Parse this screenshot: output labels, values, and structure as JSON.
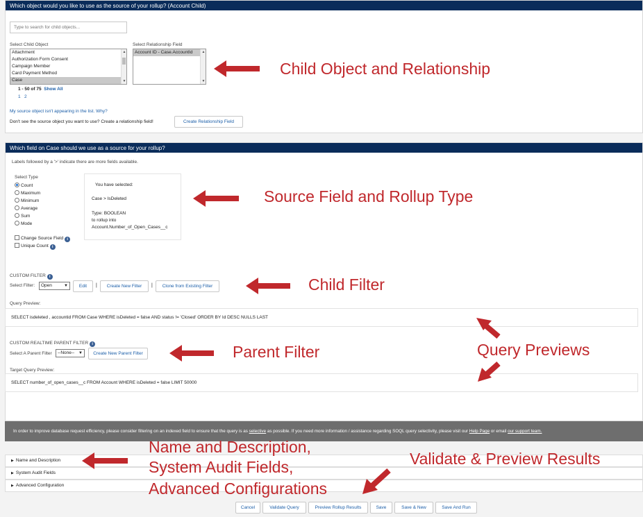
{
  "section1": {
    "header": "Which object would you like to use as the source of your rollup? (Account Child)",
    "search_placeholder": "Type to search for child objects...",
    "child_object_label": "Select Child Object",
    "child_objects": [
      "Attachment",
      "Authorization Form Consent",
      "Campaign Member",
      "Card Payment Method",
      "Case"
    ],
    "relationship_label": "Select Relationship Field",
    "relationship_fields": [
      "Account ID - Case.AccountId"
    ],
    "pagination_count": "1 - 50 of 75",
    "show_all": "Show All",
    "pages": [
      "1",
      "2"
    ],
    "missing_source_link": "My source object isn't appearing in the list. Why?",
    "create_prompt": "Don't see the source object you want to use? Create a relationship field!",
    "create_relationship_button": "Create Relationship Field"
  },
  "section2": {
    "header": "Which field on Case should we use as a source for your rollup?",
    "hint": "Labels followed by a '>' indicate there are more fields available.",
    "select_type_label": "Select Type",
    "types": [
      "Count",
      "Maximum",
      "Minimum",
      "Average",
      "Sum",
      "Mode"
    ],
    "selected_type_index": 0,
    "change_source_field": "Change Source Field",
    "unique_count": "Unique Count",
    "selected_box": {
      "title": "You have selected:",
      "path": "Case > IsDeleted",
      "type_line": "Type: BOOLEAN",
      "rollup_into": "to rollup into",
      "target": "Account.Number_of_Open_Cases__c"
    },
    "custom_filter_label": "CUSTOM FILTER",
    "select_filter_label": "Select Filter:",
    "filter_value": "Open",
    "edit_button": "Edit",
    "separator": "|",
    "create_filter_button": "Create New Filter",
    "clone_filter_button": "Clone from Existing Filter",
    "query_preview_label": "Query Preview:",
    "query_preview": "SELECT isdeleted , accountid FROM Case WHERE isDeleted = false AND status != 'Closed' ORDER BY Id DESC NULLS LAST",
    "parent_filter_label": "CUSTOM REALTIME PARENT FILTER",
    "select_parent_filter_label": "Select A Parent Filter",
    "parent_filter_value": "--None--",
    "create_parent_filter_button": "Create New Parent Filter",
    "target_query_label": "Target Query Preview:",
    "target_query": "SELECT number_of_open_cases__c FROM Account WHERE isDeleted = false LIMIT 50000"
  },
  "notice": {
    "text_before": "In order to improve database request efficiency, please consider filtering on an indexed field to ensure that the query is as",
    "selective_link": "selective",
    "text_middle": "as possible. If you need more information / assistance regarding SOQL query selectivity, please visit our",
    "help_link": "Help Page",
    "text_or": "or email",
    "support_link": "our support team."
  },
  "accordions": [
    "Name and Description",
    "System Audit Fields",
    "Advanced Configuration"
  ],
  "footer_buttons": [
    "Cancel",
    "Validate Query",
    "Preview Rollup Results",
    "Save",
    "Save & New",
    "Save And Run"
  ],
  "annotations": {
    "child_object": "Child Object and Relationship",
    "source_field": "Source Field and Rollup Type",
    "child_filter": "Child Filter",
    "parent_filter": "Parent Filter",
    "query_previews": "Query Previews",
    "name_desc_1": "Name and Description,",
    "name_desc_2": "System Audit Fields,",
    "name_desc_3": "Advanced Configurations",
    "validate_preview": "Validate & Preview Results"
  },
  "colors": {
    "header_bg": "#0a2c5a",
    "annotation_red": "#c0282c",
    "link_blue": "#1b5ea8",
    "notice_bg": "#6e6e6e"
  }
}
